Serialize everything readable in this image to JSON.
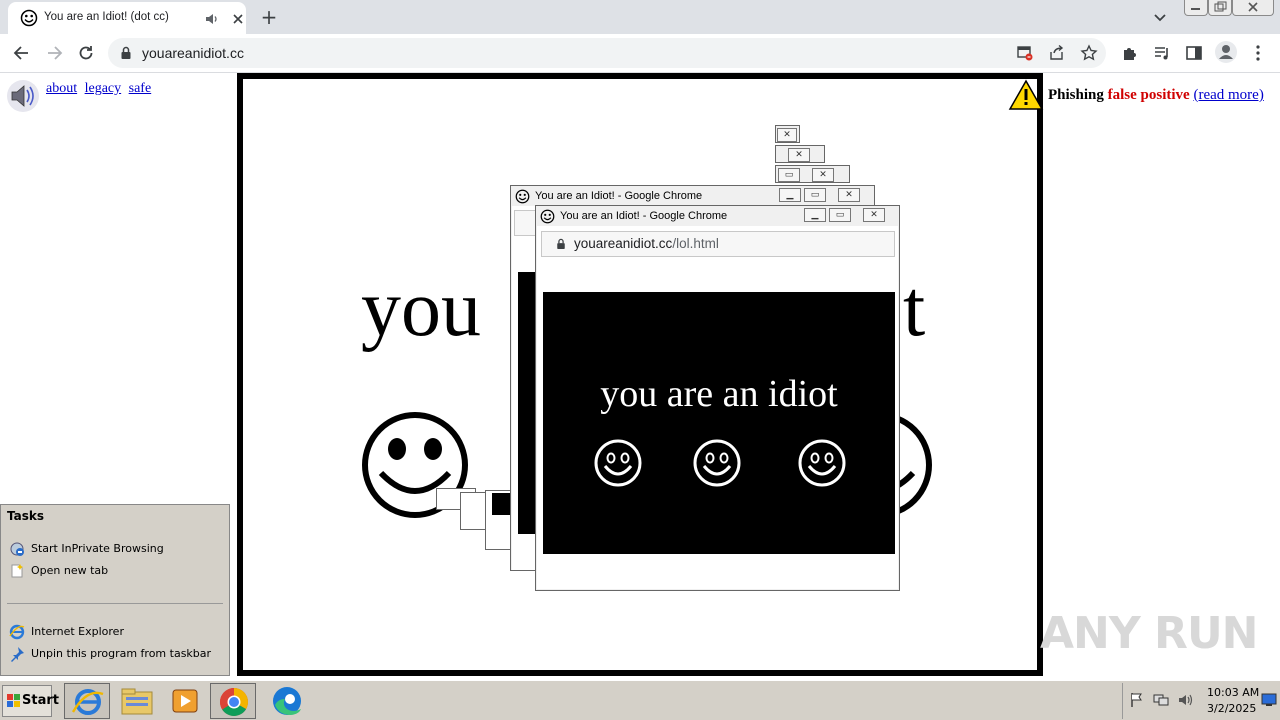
{
  "browser": {
    "tab_title": "You are an Idiot! (dot cc)",
    "new_tab_glyph": "+",
    "url": "youareanidiot.cc"
  },
  "page": {
    "nav_links": [
      "about",
      "legacy",
      "safe"
    ],
    "big_text_left": "you",
    "big_text_right": "t",
    "warning": {
      "phishing": "Phishing",
      "false_positive": "false positive",
      "read_more": "(read more)"
    },
    "watermark": "ANY RUN"
  },
  "popups": {
    "back_title": "You are an Idiot! - Google Chrome",
    "front_title": "You are an Idiot! - Google Chrome",
    "front_url_host": "youareanidiot.cc",
    "front_url_path": "/lol.html",
    "inner_text": "you are an idiot"
  },
  "tasks": {
    "title": "Tasks",
    "items": [
      "Start InPrivate Browsing",
      "Open new tab",
      "Internet Explorer",
      "Unpin this program from taskbar"
    ]
  },
  "taskbar": {
    "start_label": "Start",
    "time": "10:03 AM",
    "date": "3/2/2025"
  }
}
